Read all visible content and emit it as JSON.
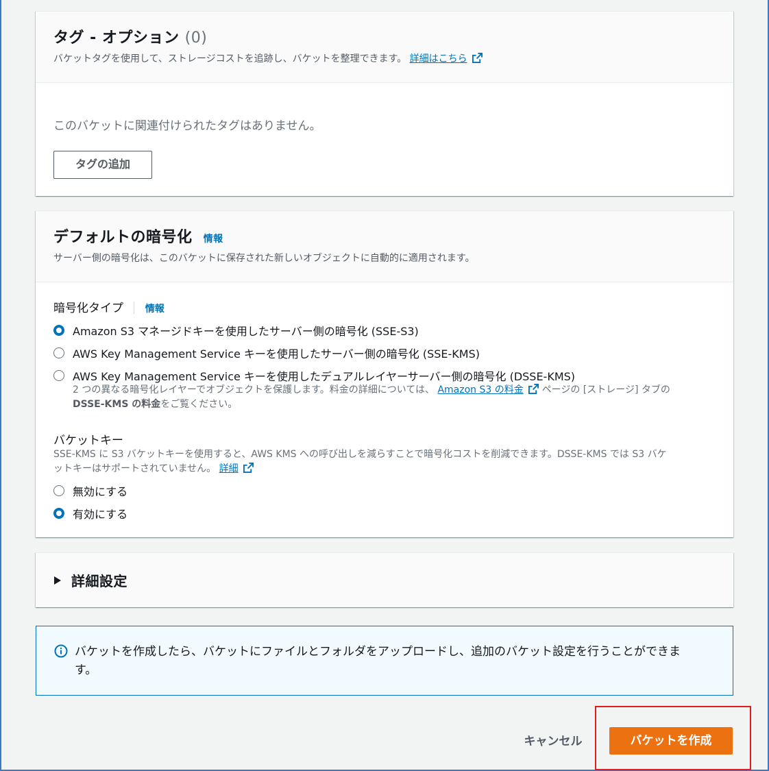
{
  "tags": {
    "title": "タグ - オプション",
    "count": "(0)",
    "description": "バケットタグを使用して、ストレージコストを追跡し、バケットを整理できます。",
    "learn_more": "詳細はこちら",
    "empty_text": "このバケットに関連付けられたタグはありません。",
    "add_button": "タグの追加"
  },
  "encryption": {
    "title": "デフォルトの暗号化",
    "info": "情報",
    "description": "サーバー側の暗号化は、このバケットに保存された新しいオブジェクトに自動的に適用されます。",
    "type_label": "暗号化タイプ",
    "type_info": "情報",
    "options": [
      {
        "label": "Amazon S3 マネージドキーを使用したサーバー側の暗号化 (SSE-S3)",
        "checked": true
      },
      {
        "label": "AWS Key Management Service キーを使用したサーバー側の暗号化 (SSE-KMS)",
        "checked": false
      },
      {
        "label": "AWS Key Management Service キーを使用したデュアルレイヤーサーバー側の暗号化 (DSSE-KMS)",
        "checked": false
      }
    ],
    "dsse_desc_1": "2 つの異なる暗号化レイヤーでオブジェクトを保護します。料金の詳細については、",
    "dsse_link": "Amazon S3 の料金",
    "dsse_desc_2": "ページの [ストレージ] タブの",
    "dsse_desc_3": "DSSE-KMS の料金",
    "dsse_desc_4": "をご覧ください。",
    "bucket_key_label": "バケットキー",
    "bucket_key_desc_1": "SSE-KMS に S3 バケットキーを使用すると、AWS KMS への呼び出しを減らすことで暗号化コストを削減できます。DSSE-KMS では S3 バケ",
    "bucket_key_desc_2": "ットキーはサポートされていません。",
    "bucket_key_link": "詳細",
    "bucket_key_options": [
      {
        "label": "無効にする",
        "checked": false
      },
      {
        "label": "有効にする",
        "checked": true
      }
    ]
  },
  "advanced": {
    "title": "詳細設定"
  },
  "alert": {
    "line1": "バケットを作成したら、バケットにファイルとフォルダをアップロードし、追加のバケット設定を行うことができま",
    "line2": "す。"
  },
  "footer": {
    "cancel": "キャンセル",
    "create": "バケットを作成"
  },
  "colors": {
    "primary": "#ec7211",
    "link": "#0073bb",
    "highlight": "#e21a1a"
  }
}
